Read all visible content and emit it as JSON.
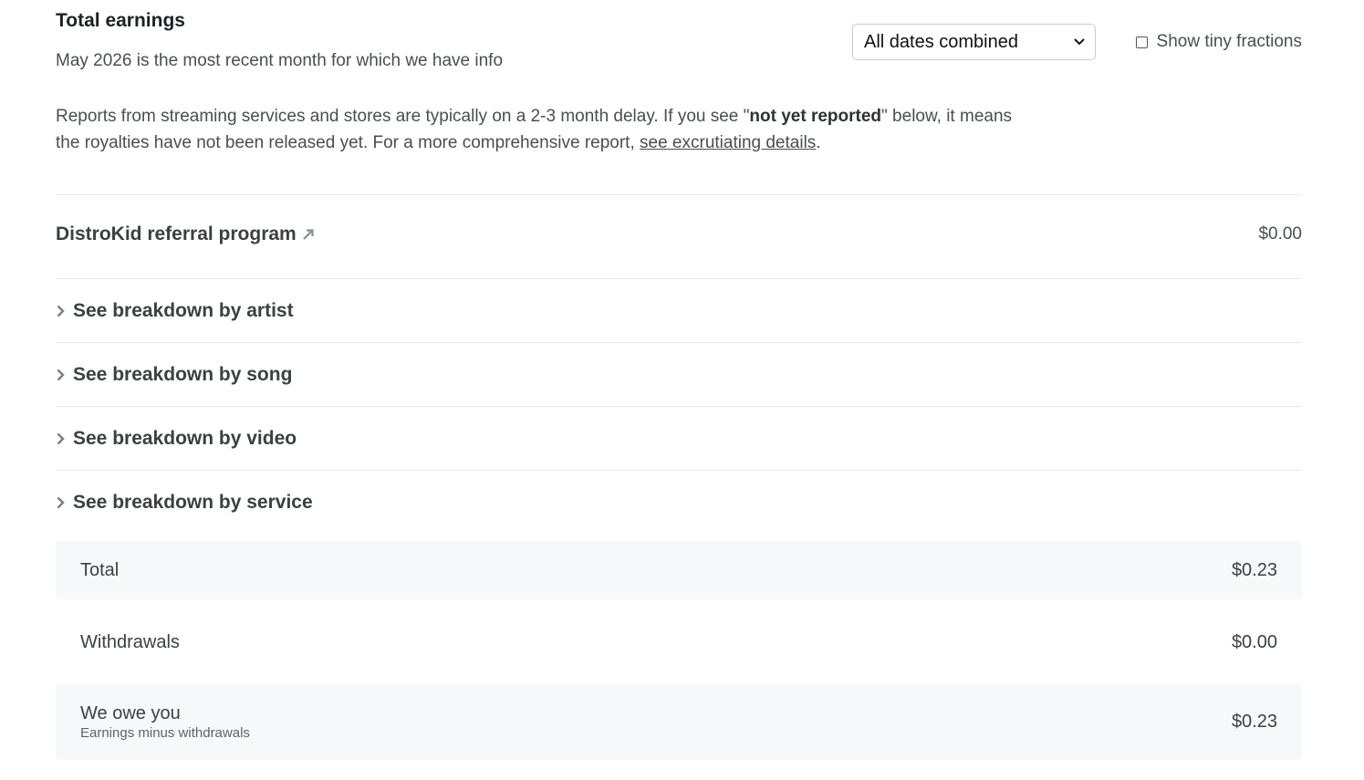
{
  "header": {
    "title": "Total earnings",
    "subtitle": "May 2026 is the most recent month for which we have info"
  },
  "date_filter": {
    "selected": "All dates combined"
  },
  "fractions_toggle": {
    "label": "Show tiny fractions",
    "checked": false
  },
  "note": {
    "part1": "Reports from streaming services and stores are typically on a 2-3 month delay. If you see \"",
    "bold": "not yet reported",
    "part2": "\" below, it means the royalties have not been released yet. For a more comprehensive report, ",
    "link": "see excrutiating details",
    "part3": "."
  },
  "referral": {
    "label": "DistroKid referral program",
    "amount": "$0.00"
  },
  "breakdowns": [
    {
      "label": "See breakdown by artist"
    },
    {
      "label": "See breakdown by song"
    },
    {
      "label": "See breakdown by video"
    },
    {
      "label": "See breakdown by service"
    }
  ],
  "summary": {
    "total_label": "Total",
    "total_amount": "$0.23",
    "withdrawals_label": "Withdrawals",
    "withdrawals_amount": "$0.00",
    "owe_label": "We owe you",
    "owe_sub": "Earnings minus withdrawals",
    "owe_amount": "$0.23"
  },
  "colors": {
    "text": "#3c4043",
    "rule": "#e6e8eb",
    "shade": "#f7f8fa"
  },
  "icons": {
    "external": "external-link-arrow-icon",
    "chevron": "chevron-right-icon",
    "select": "chevron-down-icon"
  }
}
